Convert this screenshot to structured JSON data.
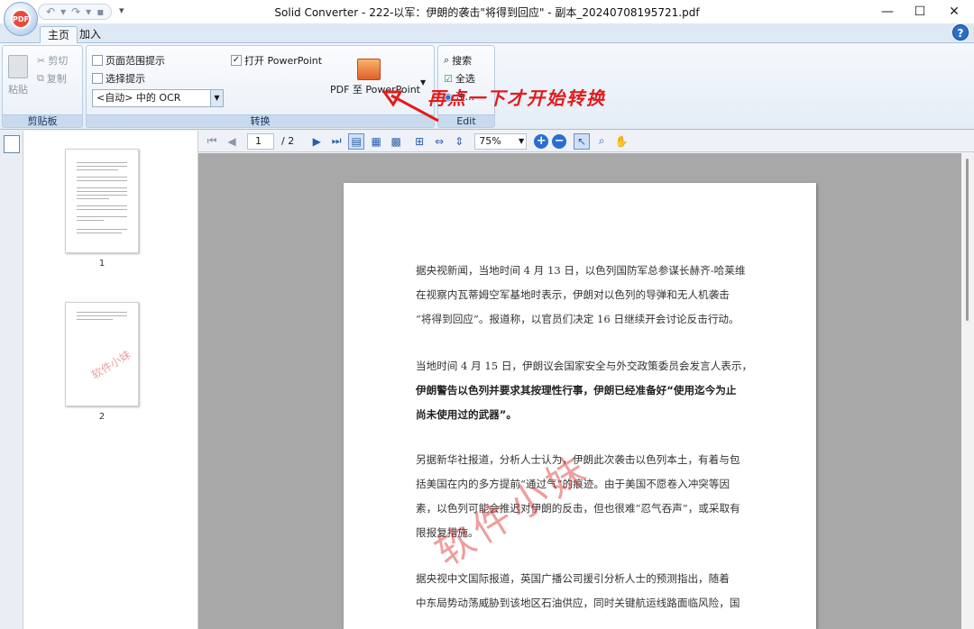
{
  "window": {
    "title": "Solid Converter - 222-以军：伊朗的袭击\"将得到回应\" - 副本_20240708195721.pdf",
    "app_badge": "PDF"
  },
  "tabs": [
    {
      "label": "主页",
      "active": true
    },
    {
      "label": "加入",
      "active": false
    }
  ],
  "ribbon": {
    "clipboard": {
      "paste": "粘贴",
      "cut": "剪切",
      "copy": "复制",
      "group_label": "剪贴板"
    },
    "convert": {
      "page_range_hint": "页面范围提示",
      "select_hint": "选择提示",
      "ocr_option": "<自动> 中的 OCR",
      "open_powerpoint": "打开 PowerPoint",
      "convert_button": "PDF 至 PowerPoint",
      "group_label": "转换"
    },
    "edit": {
      "search": "搜索",
      "select_all": "全选",
      "annotate": "注...",
      "group_label": "Edit"
    }
  },
  "annotation_text": "再点一下才开始转换",
  "thumbnails": [
    {
      "page": "1"
    },
    {
      "page": "2",
      "stamp": "软件小妹"
    }
  ],
  "navigation": {
    "current_page": "1",
    "total_pages": "/ 2",
    "zoom": "75%"
  },
  "document": {
    "paragraphs": [
      {
        "bold": false,
        "lines": [
          "据央视新闻，当地时间 4 月 13 日，以色列国防军总参谋长赫齐-哈莱维",
          "在视察内瓦蒂姆空军基地时表示，伊朗对以色列的导弹和无人机袭击",
          "“将得到回应”。报道称，以官员们决定 16 日继续开会讨论反击行动。"
        ]
      },
      {
        "bold": false,
        "lines": [
          "当地时间 4 月 15 日，伊朗议会国家安全与外交政策委员会发言人表示，"
        ]
      },
      {
        "bold": true,
        "lines": [
          "伊朗警告以色列并要求其按理性行事，伊朗已经准备好“使用迄今为止",
          "尚未使用过的武器”。"
        ]
      },
      {
        "bold": false,
        "lines": [
          "另据新华社报道，分析人士认为，伊朗此次袭击以色列本土，有着与包",
          "括美国在内的多方提前“通过气”的痕迹。由于美国不愿卷入冲突等因",
          "素，以色列可能会推迟对伊朗的反击，但也很难“忍气吞声”，或采取有",
          "限报复措施。"
        ]
      },
      {
        "bold": false,
        "lines": [
          "据央视中文国际报道，英国广播公司援引分析人士的预测指出，随着",
          "中东局势动荡威胁到该地区石油供应，同时关键航运线路面临风险，国"
        ]
      }
    ],
    "watermark": "软件小妹"
  }
}
